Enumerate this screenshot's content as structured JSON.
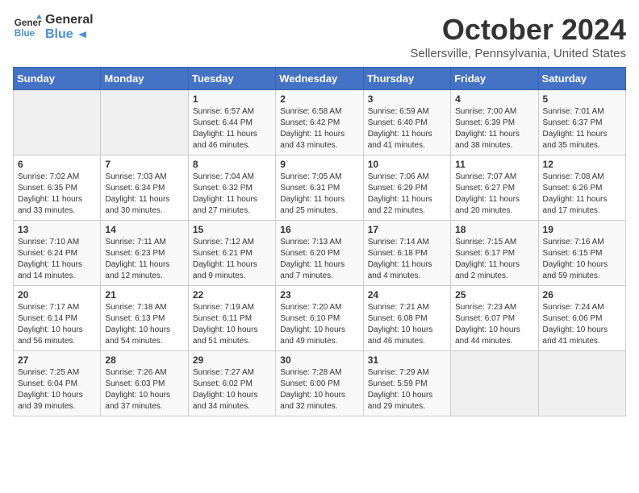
{
  "header": {
    "logo_line1": "General",
    "logo_line2": "Blue",
    "month": "October 2024",
    "location": "Sellersville, Pennsylvania, United States"
  },
  "days_of_week": [
    "Sunday",
    "Monday",
    "Tuesday",
    "Wednesday",
    "Thursday",
    "Friday",
    "Saturday"
  ],
  "weeks": [
    [
      {
        "day": "",
        "empty": true
      },
      {
        "day": "",
        "empty": true
      },
      {
        "day": "1",
        "info": "Sunrise: 6:57 AM\nSunset: 6:44 PM\nDaylight: 11 hours\nand 46 minutes."
      },
      {
        "day": "2",
        "info": "Sunrise: 6:58 AM\nSunset: 6:42 PM\nDaylight: 11 hours\nand 43 minutes."
      },
      {
        "day": "3",
        "info": "Sunrise: 6:59 AM\nSunset: 6:40 PM\nDaylight: 11 hours\nand 41 minutes."
      },
      {
        "day": "4",
        "info": "Sunrise: 7:00 AM\nSunset: 6:39 PM\nDaylight: 11 hours\nand 38 minutes."
      },
      {
        "day": "5",
        "info": "Sunrise: 7:01 AM\nSunset: 6:37 PM\nDaylight: 11 hours\nand 35 minutes."
      }
    ],
    [
      {
        "day": "6",
        "info": "Sunrise: 7:02 AM\nSunset: 6:35 PM\nDaylight: 11 hours\nand 33 minutes."
      },
      {
        "day": "7",
        "info": "Sunrise: 7:03 AM\nSunset: 6:34 PM\nDaylight: 11 hours\nand 30 minutes."
      },
      {
        "day": "8",
        "info": "Sunrise: 7:04 AM\nSunset: 6:32 PM\nDaylight: 11 hours\nand 27 minutes."
      },
      {
        "day": "9",
        "info": "Sunrise: 7:05 AM\nSunset: 6:31 PM\nDaylight: 11 hours\nand 25 minutes."
      },
      {
        "day": "10",
        "info": "Sunrise: 7:06 AM\nSunset: 6:29 PM\nDaylight: 11 hours\nand 22 minutes."
      },
      {
        "day": "11",
        "info": "Sunrise: 7:07 AM\nSunset: 6:27 PM\nDaylight: 11 hours\nand 20 minutes."
      },
      {
        "day": "12",
        "info": "Sunrise: 7:08 AM\nSunset: 6:26 PM\nDaylight: 11 hours\nand 17 minutes."
      }
    ],
    [
      {
        "day": "13",
        "info": "Sunrise: 7:10 AM\nSunset: 6:24 PM\nDaylight: 11 hours\nand 14 minutes."
      },
      {
        "day": "14",
        "info": "Sunrise: 7:11 AM\nSunset: 6:23 PM\nDaylight: 11 hours\nand 12 minutes."
      },
      {
        "day": "15",
        "info": "Sunrise: 7:12 AM\nSunset: 6:21 PM\nDaylight: 11 hours\nand 9 minutes."
      },
      {
        "day": "16",
        "info": "Sunrise: 7:13 AM\nSunset: 6:20 PM\nDaylight: 11 hours\nand 7 minutes."
      },
      {
        "day": "17",
        "info": "Sunrise: 7:14 AM\nSunset: 6:18 PM\nDaylight: 11 hours\nand 4 minutes."
      },
      {
        "day": "18",
        "info": "Sunrise: 7:15 AM\nSunset: 6:17 PM\nDaylight: 11 hours\nand 2 minutes."
      },
      {
        "day": "19",
        "info": "Sunrise: 7:16 AM\nSunset: 6:15 PM\nDaylight: 10 hours\nand 59 minutes."
      }
    ],
    [
      {
        "day": "20",
        "info": "Sunrise: 7:17 AM\nSunset: 6:14 PM\nDaylight: 10 hours\nand 56 minutes."
      },
      {
        "day": "21",
        "info": "Sunrise: 7:18 AM\nSunset: 6:13 PM\nDaylight: 10 hours\nand 54 minutes."
      },
      {
        "day": "22",
        "info": "Sunrise: 7:19 AM\nSunset: 6:11 PM\nDaylight: 10 hours\nand 51 minutes."
      },
      {
        "day": "23",
        "info": "Sunrise: 7:20 AM\nSunset: 6:10 PM\nDaylight: 10 hours\nand 49 minutes."
      },
      {
        "day": "24",
        "info": "Sunrise: 7:21 AM\nSunset: 6:08 PM\nDaylight: 10 hours\nand 46 minutes."
      },
      {
        "day": "25",
        "info": "Sunrise: 7:23 AM\nSunset: 6:07 PM\nDaylight: 10 hours\nand 44 minutes."
      },
      {
        "day": "26",
        "info": "Sunrise: 7:24 AM\nSunset: 6:06 PM\nDaylight: 10 hours\nand 41 minutes."
      }
    ],
    [
      {
        "day": "27",
        "info": "Sunrise: 7:25 AM\nSunset: 6:04 PM\nDaylight: 10 hours\nand 39 minutes."
      },
      {
        "day": "28",
        "info": "Sunrise: 7:26 AM\nSunset: 6:03 PM\nDaylight: 10 hours\nand 37 minutes."
      },
      {
        "day": "29",
        "info": "Sunrise: 7:27 AM\nSunset: 6:02 PM\nDaylight: 10 hours\nand 34 minutes."
      },
      {
        "day": "30",
        "info": "Sunrise: 7:28 AM\nSunset: 6:00 PM\nDaylight: 10 hours\nand 32 minutes."
      },
      {
        "day": "31",
        "info": "Sunrise: 7:29 AM\nSunset: 5:59 PM\nDaylight: 10 hours\nand 29 minutes."
      },
      {
        "day": "",
        "empty": true
      },
      {
        "day": "",
        "empty": true
      }
    ]
  ]
}
